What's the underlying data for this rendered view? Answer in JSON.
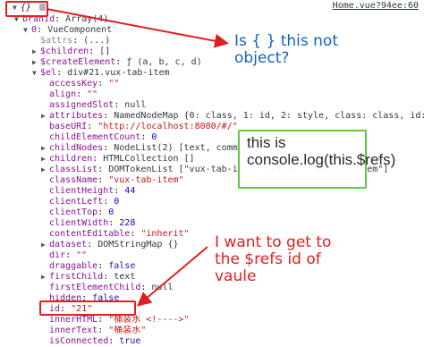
{
  "source_link": "Home.vue?94ee:60",
  "tree": {
    "root": "{}",
    "lines": [
      {
        "indent": 1,
        "arrow": "▼",
        "key": "branid",
        "sep": ": ",
        "val": "Array(4)",
        "kc": "k-purple",
        "vc": "v-obj"
      },
      {
        "indent": 2,
        "arrow": "▼",
        "key": "0",
        "sep": ": ",
        "val": "VueComponent",
        "kc": "k-purple",
        "vc": "v-obj"
      },
      {
        "indent": 3,
        "arrow": "",
        "key": "$attrs",
        "sep": ": ",
        "val": "(...)",
        "kc": "k-gray",
        "vc": "v-obj"
      },
      {
        "indent": 3,
        "arrow": "▶",
        "key": "$children",
        "sep": ": ",
        "val": "[]",
        "kc": "k-purple",
        "vc": "v-obj"
      },
      {
        "indent": 3,
        "arrow": "▶",
        "key": "$createElement",
        "sep": ": ",
        "val": "ƒ (a, b, c, d)",
        "kc": "k-purple",
        "vc": "v-obj"
      },
      {
        "indent": 3,
        "arrow": "▼",
        "key": "$el",
        "sep": ": ",
        "val": "div#21.vux-tab-item",
        "kc": "k-purple",
        "vc": "v-obj"
      },
      {
        "indent": 4,
        "arrow": "",
        "key": "accessKey",
        "sep": ": ",
        "val": "\"\"",
        "kc": "k-purple",
        "vc": "v-str"
      },
      {
        "indent": 4,
        "arrow": "",
        "key": "align",
        "sep": ": ",
        "val": "\"\"",
        "kc": "k-purple",
        "vc": "v-str"
      },
      {
        "indent": 4,
        "arrow": "",
        "key": "assignedSlot",
        "sep": ": ",
        "val": "null",
        "kc": "k-purple",
        "vc": "v-obj"
      },
      {
        "indent": 4,
        "arrow": "▶",
        "key": "attributes",
        "sep": ": ",
        "val": "NamedNodeMap {0: class, 1: id, 2: style, class: class, id: id, styl",
        "kc": "k-purple",
        "vc": "v-obj"
      },
      {
        "indent": 4,
        "arrow": "",
        "key": "baseURI",
        "sep": ": ",
        "val": "\"http://localhost:8080/#/\"",
        "kc": "k-purple",
        "vc": "v-str"
      },
      {
        "indent": 4,
        "arrow": "",
        "key": "childElementCount",
        "sep": ": ",
        "val": "0",
        "kc": "k-purple",
        "vc": "v-num"
      },
      {
        "indent": 4,
        "arrow": "▶",
        "key": "childNodes",
        "sep": ": ",
        "val": "NodeList(2) [text, comment]",
        "kc": "k-purple",
        "vc": "v-obj"
      },
      {
        "indent": 4,
        "arrow": "▶",
        "key": "children",
        "sep": ": ",
        "val": "HTMLCollection []",
        "kc": "k-purple",
        "vc": "v-obj"
      },
      {
        "indent": 4,
        "arrow": "▶",
        "key": "classList",
        "sep": ": ",
        "val": "DOMTokenList [\"vux-tab-item\", value: \"vux-tab-item\"]",
        "kc": "k-purple",
        "vc": "v-obj"
      },
      {
        "indent": 4,
        "arrow": "",
        "key": "className",
        "sep": ": ",
        "val": "\"vux-tab-item\"",
        "kc": "k-purple",
        "vc": "v-str"
      },
      {
        "indent": 4,
        "arrow": "",
        "key": "clientHeight",
        "sep": ": ",
        "val": "44",
        "kc": "k-purple",
        "vc": "v-num"
      },
      {
        "indent": 4,
        "arrow": "",
        "key": "clientLeft",
        "sep": ": ",
        "val": "0",
        "kc": "k-purple",
        "vc": "v-num"
      },
      {
        "indent": 4,
        "arrow": "",
        "key": "clientTop",
        "sep": ": ",
        "val": "0",
        "kc": "k-purple",
        "vc": "v-num"
      },
      {
        "indent": 4,
        "arrow": "",
        "key": "clientWidth",
        "sep": ": ",
        "val": "228",
        "kc": "k-purple",
        "vc": "v-num"
      },
      {
        "indent": 4,
        "arrow": "",
        "key": "contentEditable",
        "sep": ": ",
        "val": "\"inherit\"",
        "kc": "k-purple",
        "vc": "v-str"
      },
      {
        "indent": 4,
        "arrow": "▶",
        "key": "dataset",
        "sep": ": ",
        "val": "DOMStringMap {}",
        "kc": "k-purple",
        "vc": "v-obj"
      },
      {
        "indent": 4,
        "arrow": "",
        "key": "dir",
        "sep": ": ",
        "val": "\"\"",
        "kc": "k-purple",
        "vc": "v-str"
      },
      {
        "indent": 4,
        "arrow": "",
        "key": "draggable",
        "sep": ": ",
        "val": "false",
        "kc": "k-purple",
        "vc": "v-blue"
      },
      {
        "indent": 4,
        "arrow": "▶",
        "key": "firstChild",
        "sep": ": ",
        "val": "text",
        "kc": "k-purple",
        "vc": "v-obj"
      },
      {
        "indent": 4,
        "arrow": "",
        "key": "firstElementChild",
        "sep": ": ",
        "val": "null",
        "kc": "k-purple",
        "vc": "v-obj"
      },
      {
        "indent": 4,
        "arrow": "",
        "key": "hidden",
        "sep": ": ",
        "val": "false",
        "kc": "k-purple",
        "vc": "v-blue"
      },
      {
        "indent": 4,
        "arrow": "",
        "key": "id",
        "sep": ": ",
        "val": "\"21\"",
        "kc": "k-purple",
        "vc": "v-str"
      },
      {
        "indent": 4,
        "arrow": "",
        "key": "innerHTML",
        "sep": ": ",
        "val": "\"桶装水 <!---->\"",
        "kc": "k-purple",
        "vc": "v-str"
      },
      {
        "indent": 4,
        "arrow": "",
        "key": "innerText",
        "sep": ": ",
        "val": "\"桶装水\"",
        "kc": "k-purple",
        "vc": "v-str"
      },
      {
        "indent": 4,
        "arrow": "",
        "key": "isConnected",
        "sep": ": ",
        "val": "true",
        "kc": "k-purple",
        "vc": "v-blue"
      }
    ]
  },
  "annotations": {
    "object_question": "Is { } this not object?",
    "console_log": "this is console.log(this.$refs)",
    "want_id": "I want to get to the $refs id of vaule"
  },
  "colors": {
    "annotation_red": "#e02020",
    "annotation_blue": "#1663b8",
    "annotation_green": "#62c843"
  }
}
